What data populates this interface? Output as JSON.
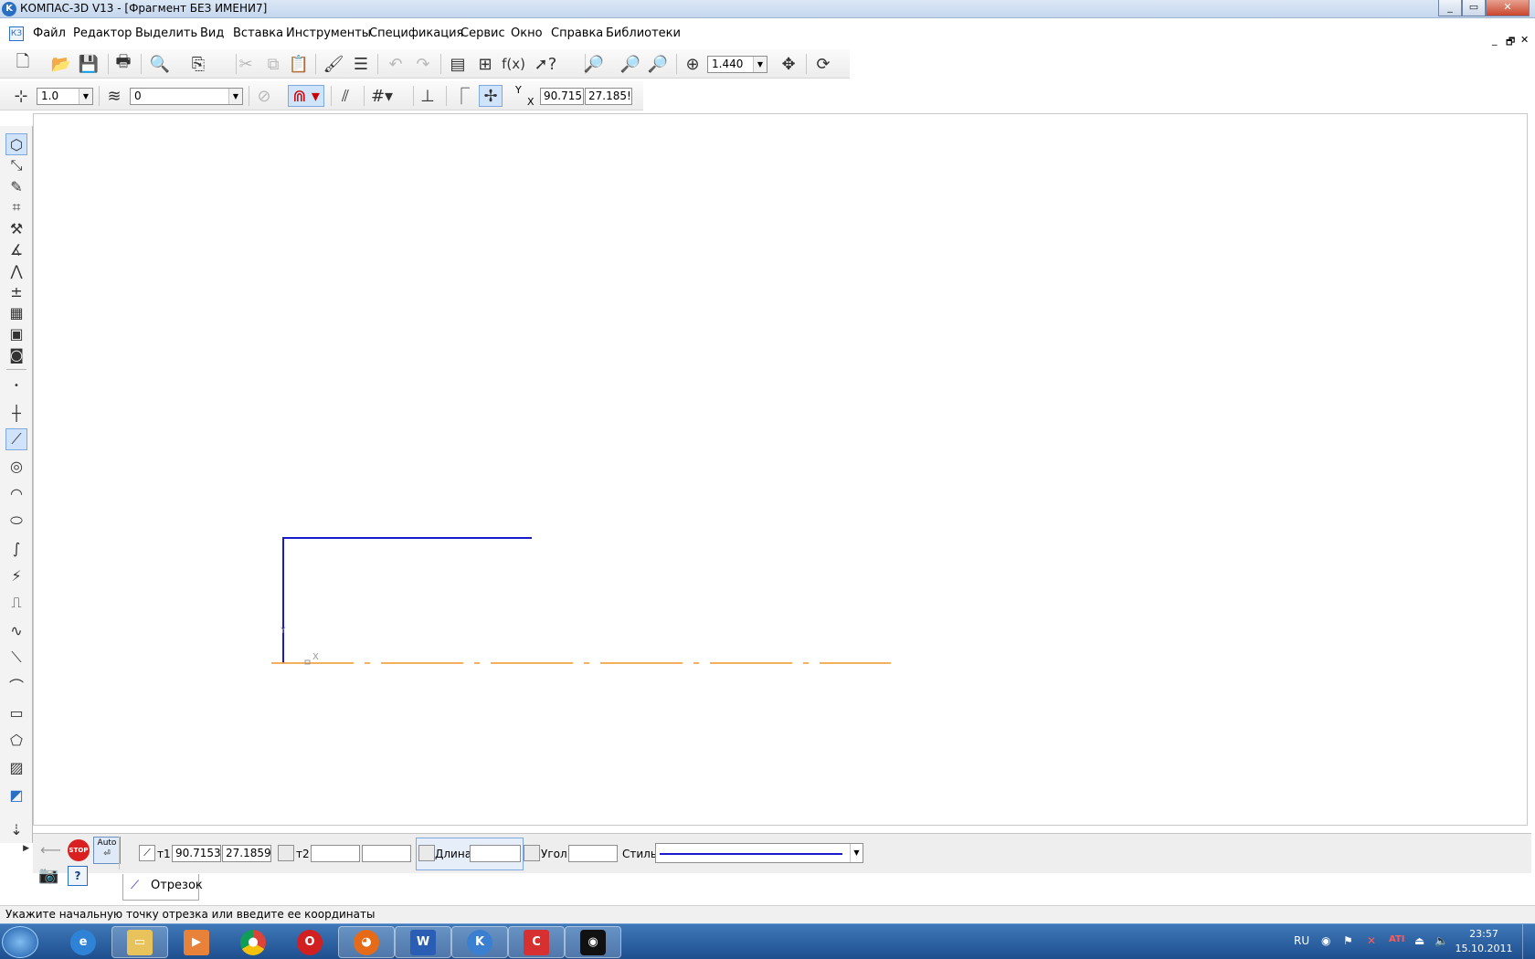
{
  "window": {
    "title": "КОМПАС-3D V13 - [Фрагмент БЕЗ ИМЕНИ7]",
    "logo": "K",
    "minimize": "_",
    "maximize": "▭",
    "close": "✕"
  },
  "menu": {
    "logo": "КЗ",
    "items": [
      "Файл",
      "Редактор",
      "Выделить",
      "Вид",
      "Вставка",
      "Инструменты",
      "Спецификация",
      "Сервис",
      "Окно",
      "Справка",
      "Библиотеки"
    ],
    "mdi_minimize": "_",
    "mdi_restore": "🗗",
    "mdi_close": "✕"
  },
  "toolbar1": {
    "zoom": "1.440",
    "fx_label": "f(x)"
  },
  "toolbar2": {
    "step": "1.0",
    "layer": "0",
    "coord_y_label": "Y",
    "coord_x_label": "X",
    "coord_x": "90.715:",
    "coord_y": "27.185!"
  },
  "props": {
    "auto_label": "Auto",
    "stop_label": "STOP",
    "t1_label": "т1",
    "t1_x": "90.7153",
    "t1_y": "27.1859",
    "t2_label": "т2",
    "t2_x": "",
    "t2_y": "",
    "length_label": "Длина",
    "length_value": "",
    "angle_label": "Угол",
    "angle_value": "",
    "style_label": "Стиль",
    "tab_label": "Отрезок"
  },
  "status_text": "Укажите начальную точку отрезка или введите ее координаты",
  "taskbar": {
    "lang": "RU",
    "time": "23:57",
    "date": "15.10.2011"
  },
  "colors": {
    "drawing_line": "#1a1acd",
    "axis_line": "#f0962a",
    "accent": "#2b6fc4"
  },
  "canvas": {
    "axis_x_label": "X",
    "axis_y_label": "Y"
  }
}
